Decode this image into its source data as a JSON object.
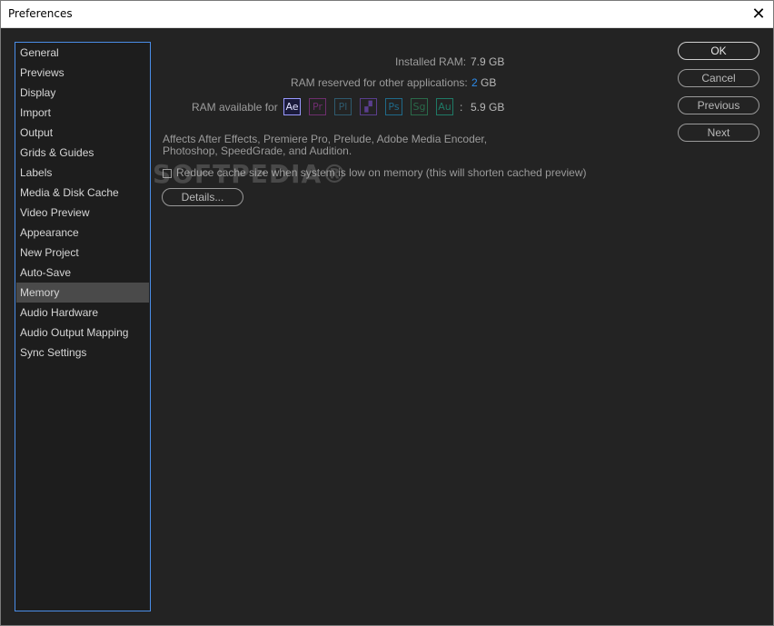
{
  "window": {
    "title": "Preferences",
    "close_glyph": "✕"
  },
  "sidebar": {
    "items": [
      {
        "label": "General"
      },
      {
        "label": "Previews"
      },
      {
        "label": "Display"
      },
      {
        "label": "Import"
      },
      {
        "label": "Output"
      },
      {
        "label": "Grids & Guides"
      },
      {
        "label": "Labels"
      },
      {
        "label": "Media & Disk Cache"
      },
      {
        "label": "Video Preview"
      },
      {
        "label": "Appearance"
      },
      {
        "label": "New Project"
      },
      {
        "label": "Auto-Save"
      },
      {
        "label": "Memory",
        "selected": true
      },
      {
        "label": "Audio Hardware"
      },
      {
        "label": "Audio Output Mapping"
      },
      {
        "label": "Sync Settings"
      }
    ],
    "selected_label": "Memory"
  },
  "memory": {
    "installed_label": "Installed RAM:",
    "installed_value": "7.9 GB",
    "reserved_label": "RAM reserved for other applications:",
    "reserved_value": "2",
    "reserved_unit": "GB",
    "available_label": "RAM available for",
    "available_sep": ":",
    "available_value": "5.9 GB",
    "apps": [
      {
        "abbr": "Ae",
        "color": "#9999ff",
        "active": true
      },
      {
        "abbr": "Pr",
        "color": "#6e2e6e"
      },
      {
        "abbr": "Pl",
        "color": "#2e5a6e"
      },
      {
        "abbr": "▞",
        "color": "#5a3e8e"
      },
      {
        "abbr": "Ps",
        "color": "#1f6a8a"
      },
      {
        "abbr": "Sg",
        "color": "#2a6a4a"
      },
      {
        "abbr": "Au",
        "color": "#1f7a66"
      }
    ],
    "description": "Affects After Effects, Premiere Pro, Prelude, Adobe Media Encoder, Photoshop, SpeedGrade, and Audition.",
    "checkbox_label": "Reduce cache size when system is low on memory (this will shorten cached preview)",
    "checkbox_checked": false,
    "details_label": "Details..."
  },
  "buttons": {
    "ok": "OK",
    "cancel": "Cancel",
    "previous": "Previous",
    "next": "Next"
  },
  "watermark": "SOFTPEDIA®",
  "colors": {
    "accent": "#2d8ceb",
    "selection_border": "#4a8ee8",
    "background": "#232323"
  }
}
